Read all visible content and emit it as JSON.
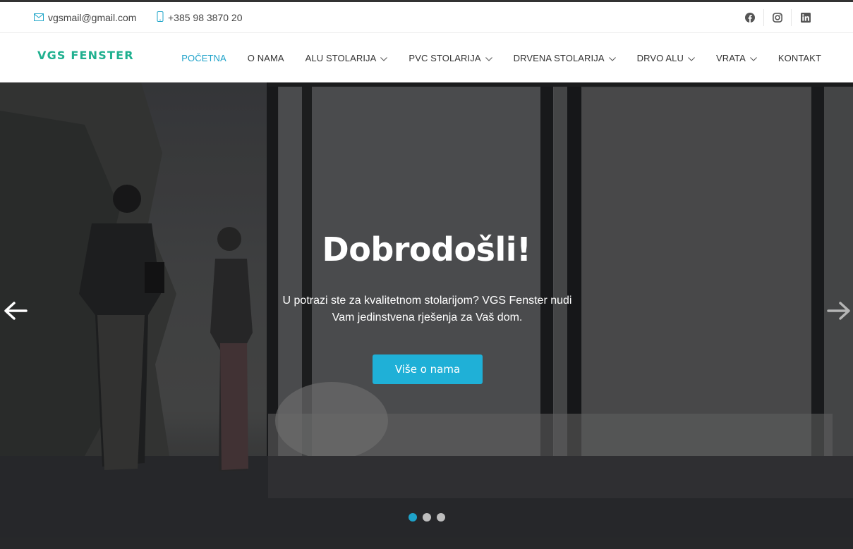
{
  "topbar": {
    "email": "vgsmail@gmail.com",
    "phone": "+385 98 3870 20",
    "socials": [
      "facebook-icon",
      "instagram-icon",
      "linkedin-icon"
    ]
  },
  "nav": {
    "logo": "VGS FENSTER",
    "items": [
      {
        "label": "POČETNA",
        "active": true,
        "dropdown": false
      },
      {
        "label": "O NAMA",
        "active": false,
        "dropdown": false
      },
      {
        "label": "ALU STOLARIJA",
        "active": false,
        "dropdown": true
      },
      {
        "label": "PVC STOLARIJA",
        "active": false,
        "dropdown": true
      },
      {
        "label": "DRVENA STOLARIJA",
        "active": false,
        "dropdown": true
      },
      {
        "label": "DRVO ALU",
        "active": false,
        "dropdown": true
      },
      {
        "label": "VRATA",
        "active": false,
        "dropdown": true
      },
      {
        "label": "KONTAKT",
        "active": false,
        "dropdown": false
      }
    ]
  },
  "hero": {
    "title": "Dobrodošli!",
    "subtitle_line1": "U potrazi ste za kvalitetnom stolarijom? VGS Fenster nudi",
    "subtitle_line2": "Vam jedinstvena rješenja za Vaš dom.",
    "button": "Više o nama",
    "slides_total": 3,
    "active_slide": 1
  },
  "colors": {
    "accent": "#1ea2c9",
    "logo": "#1fb08f",
    "button": "#1fb0d7"
  }
}
